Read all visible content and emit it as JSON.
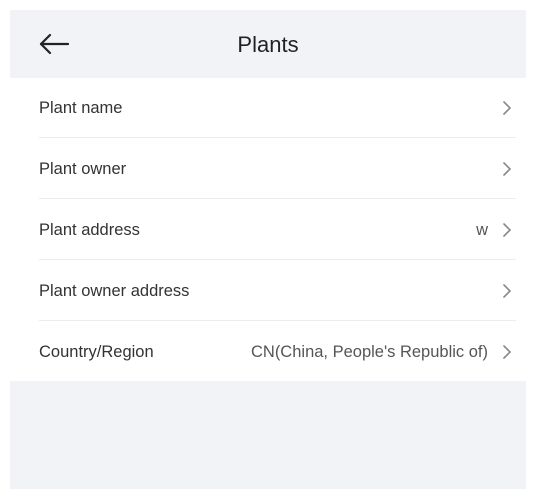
{
  "header": {
    "title": "Plants",
    "back_icon": "arrow-left-icon"
  },
  "rows": [
    {
      "label": "Plant name",
      "value": ""
    },
    {
      "label": "Plant owner",
      "value": ""
    },
    {
      "label": "Plant address",
      "value": "w"
    },
    {
      "label": "Plant owner address",
      "value": ""
    },
    {
      "label": "Country/Region",
      "value": "CN(China, People's Republic of)"
    }
  ],
  "colors": {
    "background": "#f2f3f7",
    "list_background": "#ffffff",
    "text_primary": "#333333",
    "chevron": "#888888",
    "divider": "#ececec"
  },
  "row_icon": "chevron-right-icon"
}
